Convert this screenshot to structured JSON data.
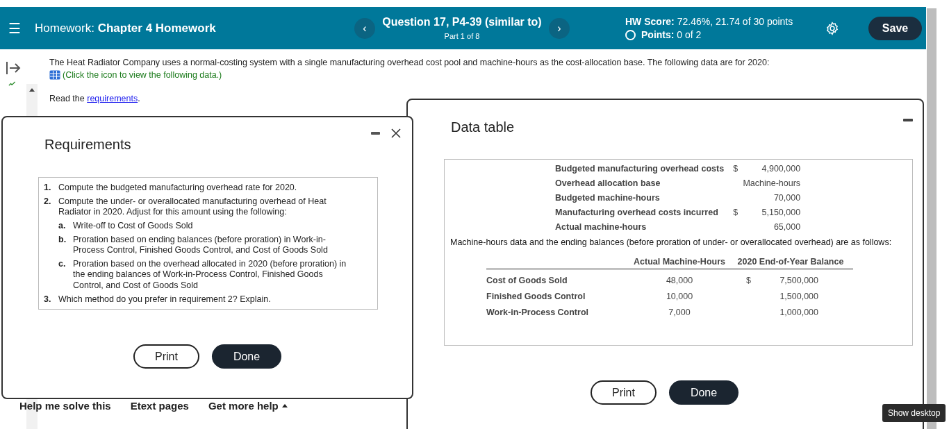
{
  "header": {
    "menu_glyph": "☰",
    "label": "Homework:",
    "title": "Chapter 4 Homework",
    "question": "Question 17, P4-39 (similar to)",
    "part": "Part 1 of 8",
    "prev_glyph": "‹",
    "next_glyph": "›",
    "score_label": "HW Score:",
    "score_value": "72.46%, 21.74 of 30 points",
    "points_label": "Points:",
    "points_value": "0 of 2",
    "save": "Save"
  },
  "problem": {
    "text": "The Heat Radiator Company uses a normal-costing system with a single manufacturing overhead cost pool and machine-hours as the cost-allocation base. The following data are for 2020:",
    "data_hint": "(Click the icon to view the following data.)",
    "read_prefix": "Read the",
    "read_link": "requirements",
    "read_suffix": "."
  },
  "footer": {
    "links": [
      "Help me solve this",
      "Etext pages",
      "Get more help"
    ]
  },
  "requirements_dialog": {
    "title": "Requirements",
    "items": [
      {
        "num": "1.",
        "text": "Compute the budgeted manufacturing overhead rate for 2020."
      },
      {
        "num": "2.",
        "text": "Compute the under- or overallocated manufacturing overhead of Heat Radiator in 2020. Adjust for this amount using the following:",
        "children": [
          {
            "num": "a.",
            "text": "Write-off to Cost of Goods Sold"
          },
          {
            "num": "b.",
            "text": "Proration based on ending balances (before proration) in Work-in-Process Control, Finished Goods Control, and Cost of Goods Sold"
          },
          {
            "num": "c.",
            "text": "Proration based on the overhead allocated in 2020 (before proration) in the ending balances of Work-in-Process Control, Finished Goods Control, and Cost of Goods Sold"
          }
        ]
      },
      {
        "num": "3.",
        "text": "Which method do you prefer in requirement 2? Explain."
      }
    ],
    "buttons": [
      "Print",
      "Done"
    ]
  },
  "data_dialog": {
    "title": "Data table",
    "facts": [
      {
        "label": "Budgeted manufacturing overhead costs",
        "currency": "$",
        "value": "4,900,000"
      },
      {
        "label": "Overhead allocation base",
        "value": "Machine-hours"
      },
      {
        "label": "Budgeted machine-hours",
        "value": "70,000"
      },
      {
        "label": "Manufacturing overhead costs incurred",
        "currency": "$",
        "value": "5,150,000"
      },
      {
        "label": "Actual machine-hours",
        "value": "65,000"
      }
    ],
    "note": "Machine-hours data and the ending balances (before proration of under- or overallocated overhead) are as follows:",
    "table": {
      "columns": [
        "Actual Machine-Hours",
        "2020 End-of-Year Balance"
      ],
      "rows": [
        {
          "account": "Cost of Goods Sold",
          "hours": "48,000",
          "currency": "$",
          "balance": "7,500,000"
        },
        {
          "account": "Finished Goods Control",
          "hours": "10,000",
          "balance": "1,500,000"
        },
        {
          "account": "Work-in-Process Control",
          "hours": "7,000",
          "balance": "1,000,000"
        }
      ]
    },
    "buttons": [
      "Print",
      "Done"
    ]
  },
  "tooltip": "Show desktop"
}
